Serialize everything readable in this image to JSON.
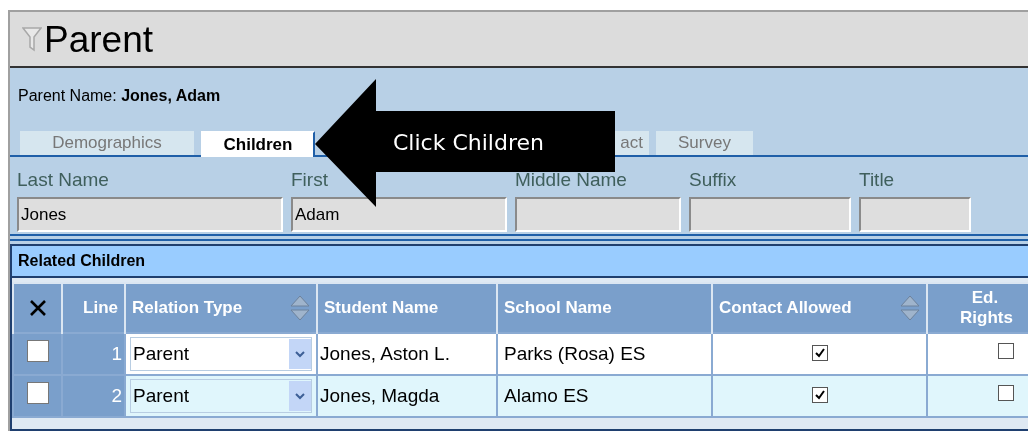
{
  "title": "Parent",
  "parent_name": "Parent Name: **Jones, Adam**",
  "tabs": [
    {
      "label": "Demographics",
      "selected": false
    },
    {
      "label": "Children",
      "selected": true
    },
    {
      "label": "act",
      "selected": false
    },
    {
      "label": "Survey",
      "selected": false
    }
  ],
  "fields": [
    {
      "label": "Last Name",
      "value": "Jones"
    },
    {
      "label": "First",
      "value": "Adam"
    },
    {
      "label": "Middle Name"
    },
    {
      "label": "Suffix"
    },
    {
      "label": "Title"
    }
  ],
  "grid": {
    "title": "Related Children",
    "columns": [
      {
        "kind": "delete"
      },
      {
        "kind": "text",
        "label": "Line",
        "sortable": false
      },
      {
        "kind": "text",
        "label": "Relation Type",
        "sortable": true
      },
      {
        "kind": "text",
        "label": "Student Name",
        "sortable": false
      },
      {
        "kind": "text",
        "label": "School Name",
        "sortable": false
      },
      {
        "kind": "text",
        "label": "Contact Allowed",
        "sortable": true
      },
      {
        "kind": "text",
        "label": "Ed. Rights",
        "sortable": false
      }
    ],
    "rows": [
      {
        "checked": false,
        "line": "1",
        "relation": "Parent",
        "student": "Jones, Aston L.",
        "school": "Parks (Rosa) ES",
        "contact_allowed": true,
        "ed_rights": false
      },
      {
        "checked": false,
        "line": "2",
        "relation": "Parent",
        "student": "Jones, Magda",
        "school": "Alamo ES",
        "contact_allowed": true,
        "ed_rights": false
      }
    ]
  },
  "callout": {
    "text": "Click Children"
  }
}
